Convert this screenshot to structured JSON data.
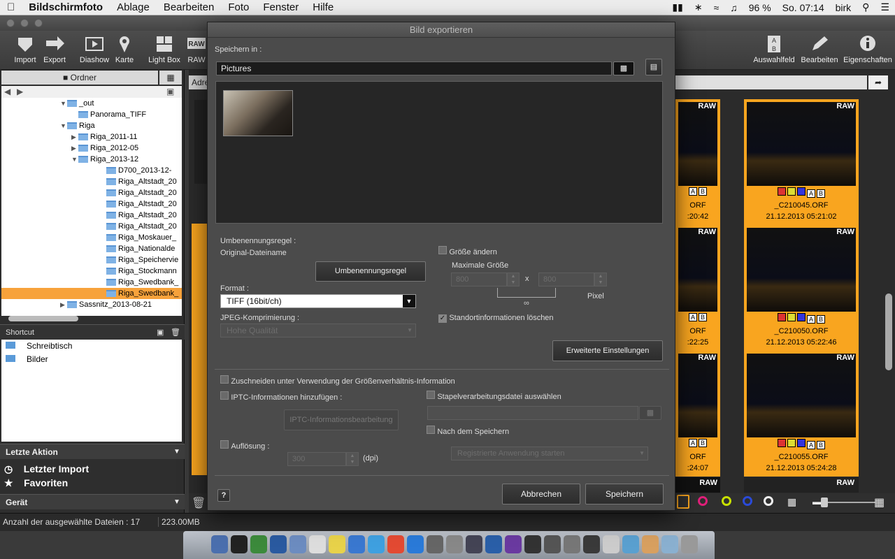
{
  "menubar": {
    "app": "Bildschirmfoto",
    "items": [
      "Ablage",
      "Bearbeiten",
      "Foto",
      "Fenster",
      "Hilfe"
    ],
    "battery": "96 %",
    "clock": "So. 07:14",
    "user": "birk"
  },
  "toolbar": {
    "left": [
      "Import",
      "Export",
      "Diashow",
      "Karte",
      "Light Box",
      "RAW"
    ],
    "right": [
      "Auswahlfeld",
      "Bearbeiten",
      "Eigenschaften"
    ]
  },
  "left": {
    "panel_title": "Ordner",
    "tree": [
      {
        "label": "_out",
        "indent": 0,
        "open": true
      },
      {
        "label": "Panorama_TIFF",
        "indent": 1
      },
      {
        "label": "Riga",
        "indent": 0,
        "open": true
      },
      {
        "label": "Riga_2011-11",
        "indent": 1,
        "closed": true
      },
      {
        "label": "Riga_2012-05",
        "indent": 1,
        "closed": true
      },
      {
        "label": "Riga_2013-12",
        "indent": 1,
        "open": true
      },
      {
        "label": "D700_2013-12-",
        "indent": 2
      },
      {
        "label": "Riga_Altstadt_20",
        "indent": 2
      },
      {
        "label": "Riga_Altstadt_20",
        "indent": 2
      },
      {
        "label": "Riga_Altstadt_20",
        "indent": 2
      },
      {
        "label": "Riga_Altstadt_20",
        "indent": 2
      },
      {
        "label": "Riga_Altstadt_20",
        "indent": 2
      },
      {
        "label": "Riga_Moskauer_",
        "indent": 2
      },
      {
        "label": "Riga_Nationalde",
        "indent": 2
      },
      {
        "label": "Riga_Speichervie",
        "indent": 2
      },
      {
        "label": "Riga_Stockmann",
        "indent": 2
      },
      {
        "label": "Riga_Swedbank_",
        "indent": 2
      },
      {
        "label": "Riga_Swedbank_",
        "indent": 2,
        "selected": true
      },
      {
        "label": "Sassnitz_2013-08-21",
        "indent": 0,
        "closed": true
      }
    ],
    "shortcut_title": "Shortcut",
    "shortcuts": [
      "Schreibtisch",
      "Bilder"
    ],
    "last_action_title": "Letzte Aktion",
    "last_actions": [
      "Letzter Import",
      "Favoriten"
    ],
    "device_title": "Gerät"
  },
  "grid": {
    "address_label": "Adre",
    "thumbs": [
      {
        "col": "right",
        "row": 0,
        "name": "_C210045.ORF",
        "date": "21.12.2013 05:21:02"
      },
      {
        "col": "right",
        "row": 1,
        "name": "_C210050.ORF",
        "date": "21.12.2013 05:22:46"
      },
      {
        "col": "right",
        "row": 2,
        "name": "_C210055.ORF",
        "date": "21.12.2013 05:24:28"
      },
      {
        "col": "left",
        "row": 0,
        "name": "ORF",
        "date": ":20:42"
      },
      {
        "col": "left",
        "row": 1,
        "name": "ORF",
        "date": ":22:25"
      },
      {
        "col": "left",
        "row": 2,
        "name": "ORF",
        "date": ":24:07"
      }
    ],
    "raw_badge": "RAW"
  },
  "status": {
    "count_text": "Anzahl der ausgewählte Dateien : 17",
    "size": "223.00MB"
  },
  "dialog": {
    "title": "Bild exportieren",
    "save_in_label": "Speichern in :",
    "save_in_value": "Pictures",
    "rename_rule_label": "Umbenennungsregel :",
    "rename_rule_value": "Original-Dateiname",
    "rename_button": "Umbenennungsregel",
    "format_label": "Format :",
    "format_value": "TIFF (16bit/ch)",
    "jpeg_label": "JPEG-Komprimierung :",
    "jpeg_value": "Hohe Qualität",
    "resize_label": "Größe ändern",
    "max_size_label": "Maximale Größe",
    "width": "800",
    "height": "800",
    "x": "x",
    "pixel": "Pixel",
    "remove_location_label": "Standortinformationen löschen",
    "advanced_button": "Erweiterte Einstellungen",
    "crop_label": "Zuschneiden unter Verwendung der Größenverhältnis-Information",
    "iptc_label": "IPTC-Informationen hinzufügen :",
    "iptc_button": "IPTC-Informationsbearbeitung",
    "batch_label": "Stapelverarbeitungsdatei auswählen",
    "after_save_label": "Nach dem Speichern",
    "after_save_value": "Registrierte Anwendung starten",
    "resolution_label": "Auflösung :",
    "resolution_value": "300",
    "dpi": "(dpi)",
    "help": "?",
    "cancel": "Abbrechen",
    "save": "Speichern"
  }
}
